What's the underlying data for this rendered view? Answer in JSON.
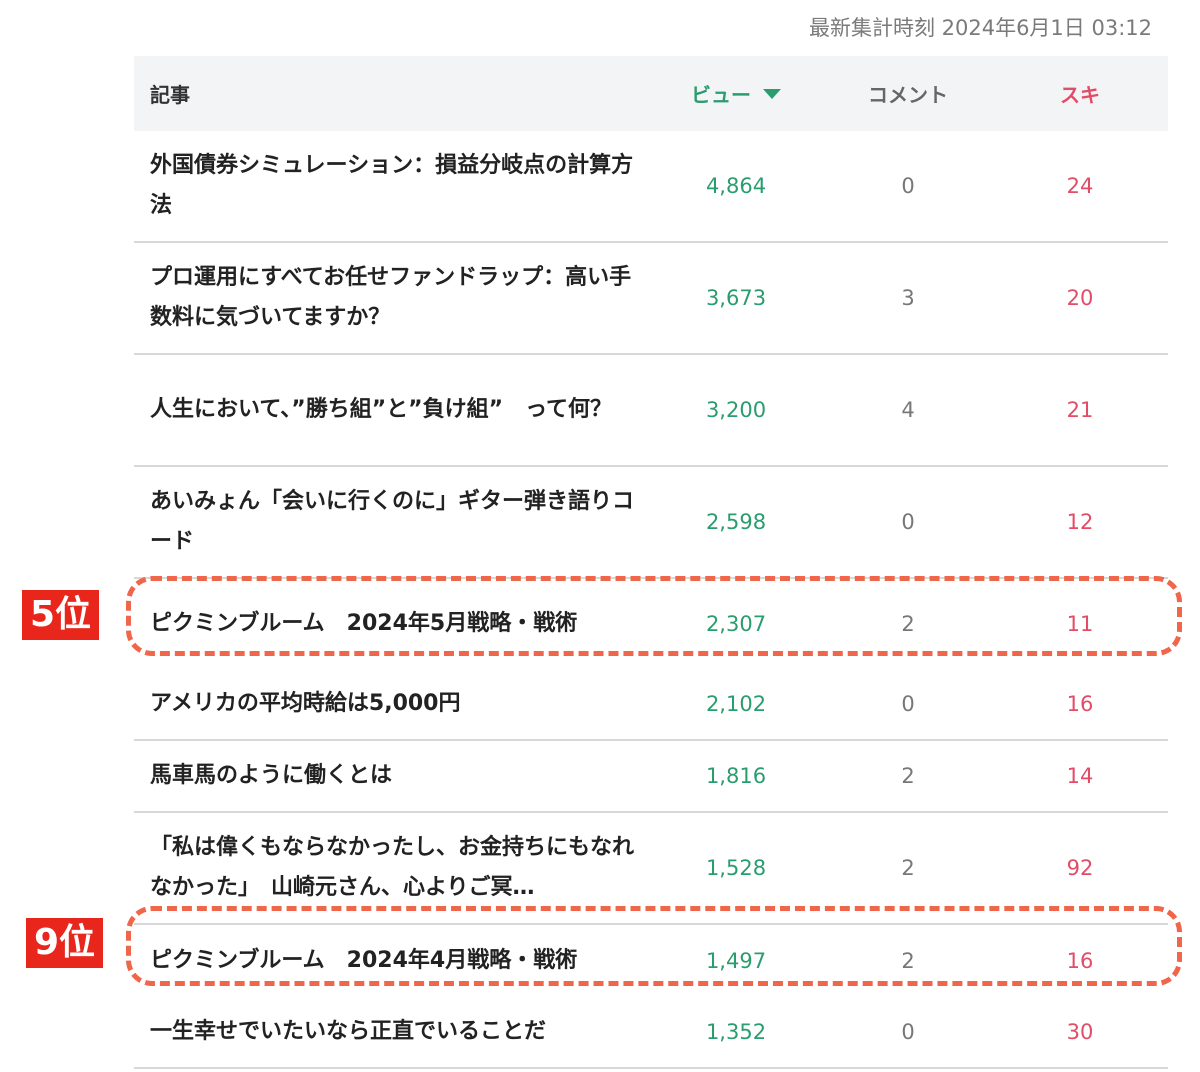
{
  "timestamp": "最新集計時刻 2024年6月1日 03:12",
  "header": {
    "title": "記事",
    "views": "ビュー",
    "comments": "コメント",
    "likes": "スキ"
  },
  "rows": [
    {
      "title": "外国債券シミュレーション：損益分岐点の計算方法",
      "views": "4,864",
      "comments": "0",
      "likes": "24"
    },
    {
      "title": "プロ運用にすべてお任せファンドラップ：高い手数料に気づいてますか？",
      "views": "3,673",
      "comments": "3",
      "likes": "20"
    },
    {
      "title": "人生において、”勝ち組”と”負け組”　って何？",
      "views": "3,200",
      "comments": "4",
      "likes": "21"
    },
    {
      "title": "あいみょん「会いに行くのに」ギター弾き語りコード",
      "views": "2,598",
      "comments": "0",
      "likes": "12"
    },
    {
      "title": "ピクミンブルーム　2024年5月戦略・戦術",
      "views": "2,307",
      "comments": "2",
      "likes": "11"
    },
    {
      "title": "アメリカの平均時給は5,000円",
      "views": "2,102",
      "comments": "0",
      "likes": "16"
    },
    {
      "title": "馬車馬のように働くとは",
      "views": "1,816",
      "comments": "2",
      "likes": "14"
    },
    {
      "title": "「私は偉くもならなかったし、お金持ちにもなれなかった」　山崎元さん、心よりご冥…",
      "views": "1,528",
      "comments": "2",
      "likes": "92"
    },
    {
      "title": "ピクミンブルーム　2024年4月戦略・戦術",
      "views": "1,497",
      "comments": "2",
      "likes": "16"
    },
    {
      "title": "一生幸せでいたいなら正直でいることだ",
      "views": "1,352",
      "comments": "0",
      "likes": "30"
    }
  ],
  "annotations": {
    "rank5": "5位",
    "rank9": "9位",
    "highlight_color": "#f0664a",
    "badge_color": "#e8261b"
  },
  "colors": {
    "views": "#2a9d6f",
    "likes": "#e24c67"
  }
}
